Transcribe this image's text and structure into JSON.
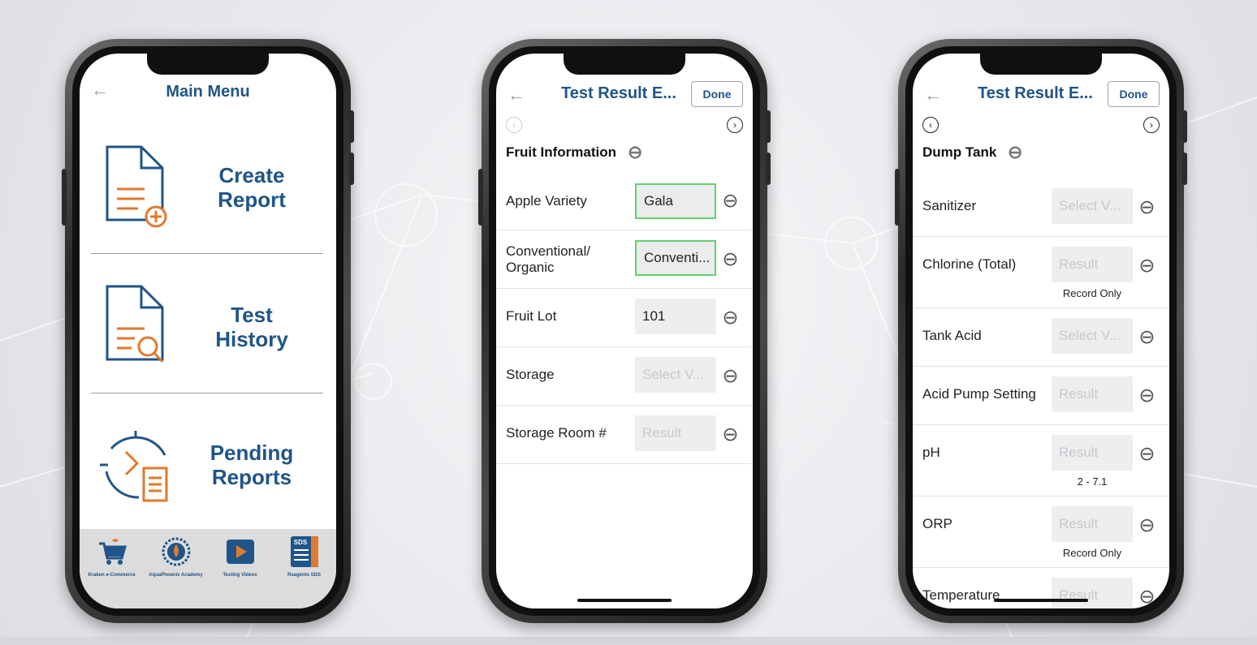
{
  "main_menu": {
    "back_icon": "←",
    "title": "Main Menu",
    "items": [
      {
        "label": "Create\nReport",
        "icon": "create-report-icon"
      },
      {
        "label": "Test\nHistory",
        "icon": "test-history-icon"
      },
      {
        "label": "Pending\nReports",
        "icon": "pending-reports-icon"
      }
    ],
    "footer": [
      {
        "label": "Kraken e-Commerce",
        "icon": "cart-icon"
      },
      {
        "label": "AquaPhoenix Academy",
        "icon": "academy-icon"
      },
      {
        "label": "Testing Videos",
        "icon": "play-icon"
      },
      {
        "label": "Reagents SDS",
        "icon": "sds-icon",
        "badge": "SDS"
      }
    ]
  },
  "fruit_screen": {
    "back_icon": "←",
    "title": "Test Result E...",
    "done": "Done",
    "prev_icon": "‹",
    "next_icon": "›",
    "section": "Fruit Information",
    "rows": [
      {
        "label": "Apple Variety",
        "value": "Gala",
        "placeholder": false,
        "highlight": true
      },
      {
        "label": "Conventional/\nOrganic",
        "value": "Conventi...",
        "placeholder": false,
        "highlight": true
      },
      {
        "label": "Fruit Lot",
        "value": "101",
        "placeholder": false,
        "highlight": false
      },
      {
        "label": "Storage",
        "value": "Select V...",
        "placeholder": true,
        "highlight": false
      },
      {
        "label": "Storage Room #",
        "value": "Result",
        "placeholder": true,
        "highlight": false
      }
    ]
  },
  "dump_screen": {
    "back_icon": "←",
    "title": "Test Result E...",
    "done": "Done",
    "prev_icon": "‹",
    "next_icon": "›",
    "section": "Dump Tank",
    "rows": [
      {
        "label": "Sanitizer",
        "value": "Select V...",
        "note": ""
      },
      {
        "label": "Chlorine (Total)",
        "value": "Result",
        "note": "Record Only"
      },
      {
        "label": "Tank Acid",
        "value": "Select V...",
        "note": ""
      },
      {
        "label": "Acid Pump Setting",
        "value": "Result",
        "note": ""
      },
      {
        "label": "pH",
        "value": "Result",
        "note": "2 - 7.1"
      },
      {
        "label": "ORP",
        "value": "Result",
        "note": "Record Only"
      },
      {
        "label": "Temperature",
        "value": "Result",
        "note": ""
      }
    ]
  },
  "colors": {
    "brand_blue": "#1f5588",
    "accent_orange": "#e07a2e",
    "highlight_green": "#5fd36a"
  }
}
